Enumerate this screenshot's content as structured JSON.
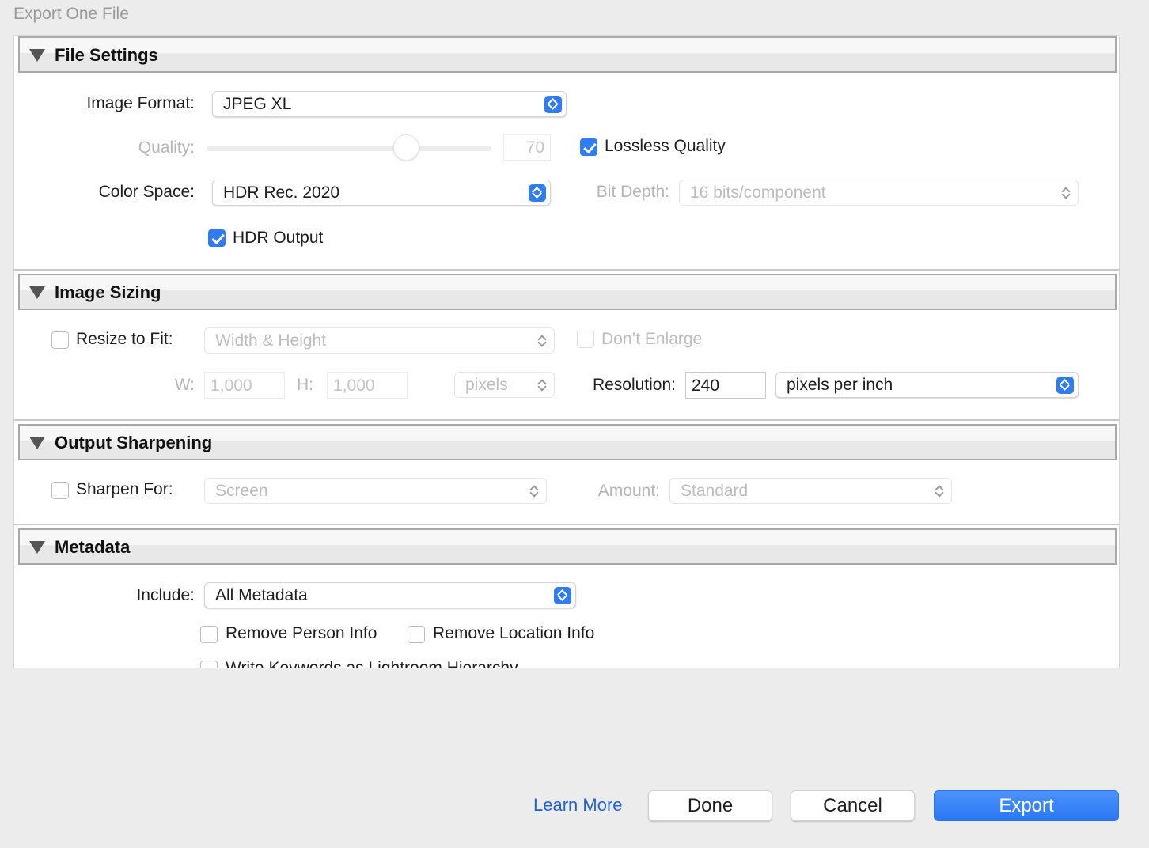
{
  "window": {
    "title": "Export One File"
  },
  "file_settings": {
    "header": "File Settings",
    "image_format_label": "Image Format:",
    "image_format_value": "JPEG XL",
    "quality_label": "Quality:",
    "quality_value": "70",
    "quality_level": 0.7,
    "lossless_label": "Lossless Quality",
    "lossless_checked": true,
    "color_space_label": "Color Space:",
    "color_space_value": "HDR Rec. 2020",
    "bit_depth_label": "Bit Depth:",
    "bit_depth_value": "16 bits/component",
    "hdr_output_label": "HDR Output",
    "hdr_output_checked": true
  },
  "image_sizing": {
    "header": "Image Sizing",
    "resize_label": "Resize to Fit:",
    "resize_checked": false,
    "resize_mode": "Width & Height",
    "dont_enlarge_label": "Don’t Enlarge",
    "w_label": "W:",
    "w_value": "1,000",
    "h_label": "H:",
    "h_value": "1,000",
    "units_value": "pixels",
    "resolution_label": "Resolution:",
    "resolution_value": "240",
    "resolution_units": "pixels per inch"
  },
  "output_sharpening": {
    "header": "Output Sharpening",
    "sharpen_label": "Sharpen For:",
    "sharpen_checked": false,
    "sharpen_value": "Screen",
    "amount_label": "Amount:",
    "amount_value": "Standard"
  },
  "metadata": {
    "header": "Metadata",
    "include_label": "Include:",
    "include_value": "All Metadata",
    "remove_person_label": "Remove Person Info",
    "remove_location_label": "Remove Location Info",
    "write_keywords_label": "Write Keywords as Lightroom Hierarchy"
  },
  "footer": {
    "learn_more": "Learn More",
    "done": "Done",
    "cancel": "Cancel",
    "export": "Export"
  },
  "colors": {
    "accent": "#2f7cf6",
    "link": "#1f63d8"
  }
}
